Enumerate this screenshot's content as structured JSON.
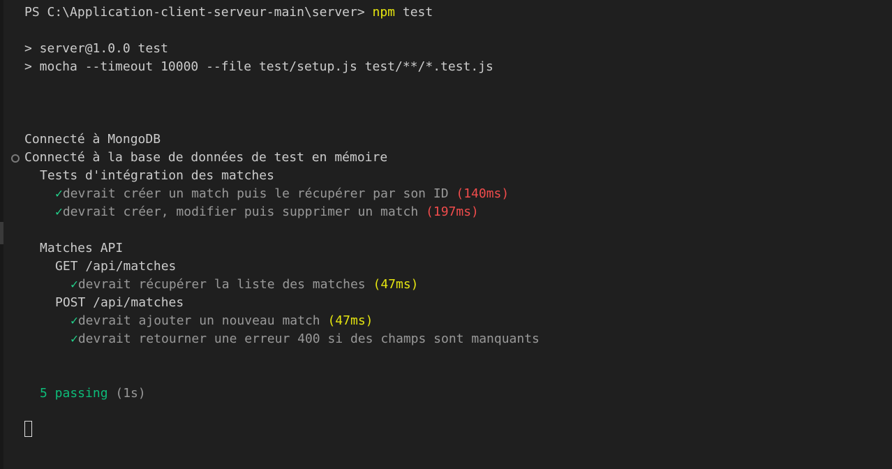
{
  "prompt": {
    "ps": "PS C:\\Application-client-serveur-main\\server> ",
    "command": "npm",
    "args": " test"
  },
  "script_lines": [
    "> server@1.0.0 test",
    "> mocha --timeout 10000 --file test/setup.js test/**/*.test.js"
  ],
  "log": {
    "mongo": "Connecté à MongoDB",
    "memory_db": "Connecté à la base de données de test en mémoire"
  },
  "suites": {
    "integration": {
      "title": "Tests d'intégration des matches",
      "tests": [
        {
          "check": "✓",
          "text": "devrait créer un match puis le récupérer par son ID",
          "duration": "(140ms)"
        },
        {
          "check": "✓",
          "text": "devrait créer, modifier puis supprimer un match",
          "duration": "(197ms)"
        }
      ]
    },
    "api": {
      "title": "Matches API",
      "get": {
        "title": "GET /api/matches",
        "tests": [
          {
            "check": "✓",
            "text": "devrait récupérer la liste des matches",
            "duration": "(47ms)"
          }
        ]
      },
      "post": {
        "title": "POST /api/matches",
        "tests": [
          {
            "check": "✓",
            "text": "devrait ajouter un nouveau match",
            "duration": "(47ms)"
          },
          {
            "check": "✓",
            "text": "devrait retourner une erreur 400 si des champs sont manquants",
            "duration": ""
          }
        ]
      }
    }
  },
  "summary": {
    "passing": "5 passing",
    "time": " (1s)"
  },
  "colors": {
    "background": "#1f1f1f",
    "text": "#cccccc",
    "command": "#e5e510",
    "slow": "#f14c4c",
    "medium": "#e5e510",
    "pass": "#23d18b"
  }
}
